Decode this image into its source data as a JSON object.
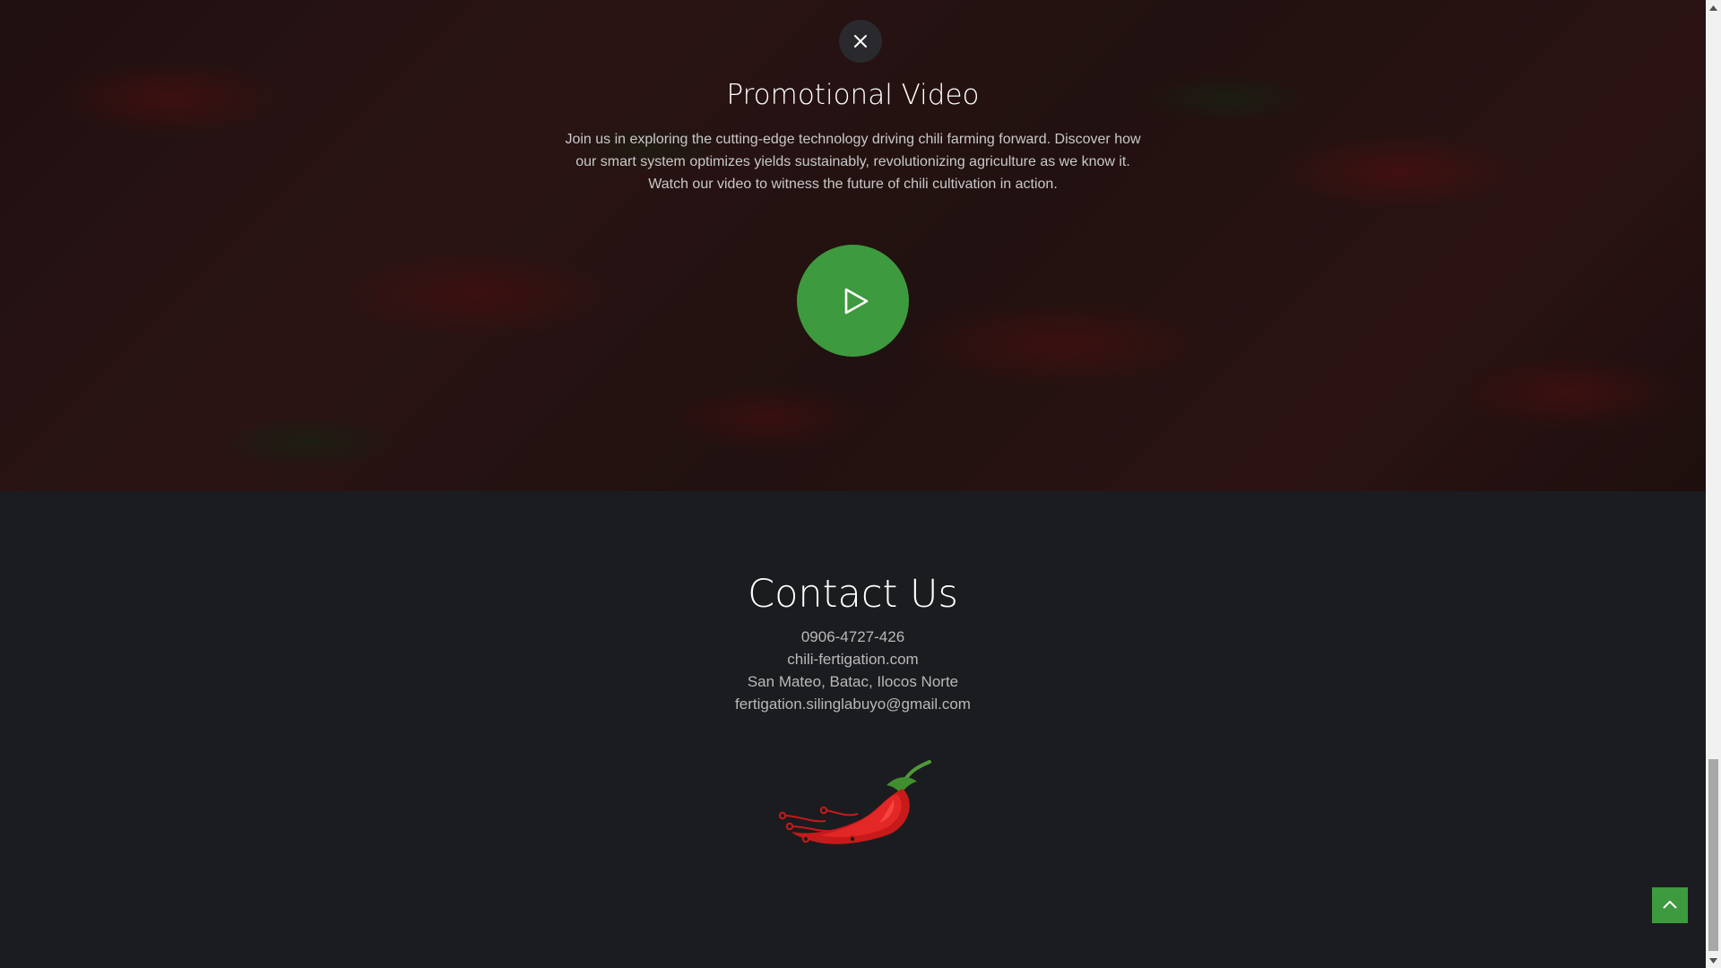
{
  "promo": {
    "close_icon": "close-icon",
    "title": "Promotional Video",
    "description": "Join us in exploring the cutting-edge technology driving chili farming forward. Discover how our smart system optimizes yields sustainably, revolutionizing agriculture as we know it. Watch our video to witness the future of chili cultivation in action.",
    "play_icon": "play-icon",
    "button_color": "#3e9a3e"
  },
  "contact": {
    "title": "Contact Us",
    "phone": "0906-4727-426",
    "website": "chili-fertigation.com",
    "address": "San Mateo, Batac, Ilocos Norte",
    "email": "fertigation.silinglabuyo@gmail.com",
    "logo": "chili-pepper-logo"
  },
  "back_to_top": {
    "icon": "chevron-up-icon",
    "color": "#3e9a3e"
  },
  "colors": {
    "footer_bg": "#1b1c20",
    "accent_green": "#3e9a3e",
    "chili_red": "#d62020"
  }
}
